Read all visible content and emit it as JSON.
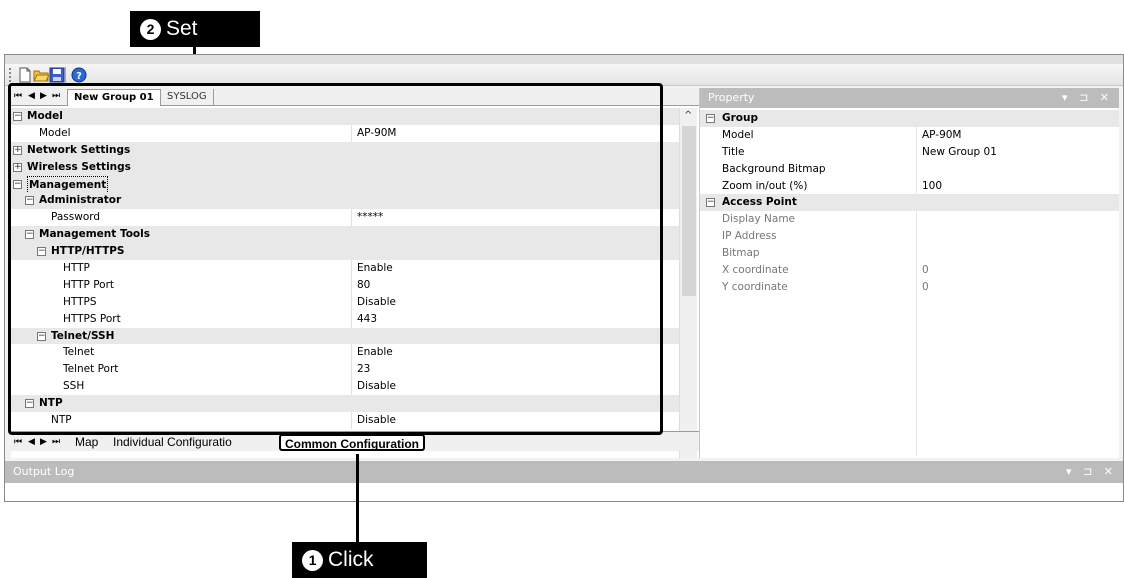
{
  "callouts": {
    "set": {
      "num": "2",
      "label": "Set"
    },
    "click": {
      "num": "1",
      "label": "Click"
    }
  },
  "tabs": {
    "top": [
      "New Group 01",
      "SYSLOG"
    ],
    "bottom": [
      "Map",
      "Individual Configuratio",
      "Common Configuration"
    ]
  },
  "grid_rows": [
    {
      "label": "Model",
      "value": "",
      "level": 0,
      "cat": true,
      "toggle": "minus"
    },
    {
      "label": "Model",
      "value": "AP-90M",
      "level": 0,
      "cat": false
    },
    {
      "label": "Network Settings",
      "value": "",
      "level": 0,
      "cat": true,
      "toggle": "plus"
    },
    {
      "label": "Wireless Settings",
      "value": "",
      "level": 0,
      "cat": true,
      "toggle": "plus"
    },
    {
      "label": "Management",
      "value": "",
      "level": 0,
      "cat": true,
      "toggle": "minus",
      "boxed": true
    },
    {
      "label": "Administrator",
      "value": "",
      "level": 1,
      "cat": true,
      "toggle": "minus"
    },
    {
      "label": "Password",
      "value": "*****",
      "level": 1,
      "cat": false
    },
    {
      "label": "Management Tools",
      "value": "",
      "level": 1,
      "cat": true,
      "toggle": "minus"
    },
    {
      "label": "HTTP/HTTPS",
      "value": "",
      "level": 2,
      "cat": true,
      "toggle": "minus"
    },
    {
      "label": "HTTP",
      "value": "Enable",
      "level": 2,
      "cat": false
    },
    {
      "label": "HTTP Port",
      "value": "80",
      "level": 2,
      "cat": false
    },
    {
      "label": "HTTPS",
      "value": "Disable",
      "level": 2,
      "cat": false
    },
    {
      "label": "HTTPS Port",
      "value": "443",
      "level": 2,
      "cat": false
    },
    {
      "label": "Telnet/SSH",
      "value": "",
      "level": 2,
      "cat": true,
      "toggle": "minus"
    },
    {
      "label": "Telnet",
      "value": "Enable",
      "level": 2,
      "cat": false
    },
    {
      "label": "Telnet Port",
      "value": "23",
      "level": 2,
      "cat": false
    },
    {
      "label": "SSH",
      "value": "Disable",
      "level": 2,
      "cat": false
    },
    {
      "label": "NTP",
      "value": "",
      "level": 1,
      "cat": true,
      "toggle": "minus"
    },
    {
      "label": "NTP",
      "value": "Disable",
      "level": 1,
      "cat": false
    }
  ],
  "property": {
    "title": "Property",
    "rows": [
      {
        "label": "Group",
        "value": "",
        "cat": true
      },
      {
        "label": "Model",
        "value": "AP-90M",
        "cat": false,
        "dim": false
      },
      {
        "label": "Title",
        "value": "New Group 01",
        "cat": false,
        "dim": false
      },
      {
        "label": "Background Bitmap",
        "value": "",
        "cat": false,
        "dim": false
      },
      {
        "label": "Zoom in/out (%)",
        "value": "100",
        "cat": false,
        "dim": false
      },
      {
        "label": "Access Point",
        "value": "",
        "cat": true
      },
      {
        "label": "Display Name",
        "value": "",
        "cat": false,
        "dim": true
      },
      {
        "label": "IP Address",
        "value": "",
        "cat": false,
        "dim": true
      },
      {
        "label": "Bitmap",
        "value": "",
        "cat": false,
        "dim": true
      },
      {
        "label": "X coordinate",
        "value": "0",
        "cat": false,
        "dim": true
      },
      {
        "label": "Y coordinate",
        "value": "0",
        "cat": false,
        "dim": true
      }
    ]
  },
  "output_log": {
    "title": "Output Log"
  },
  "pane_controls": "▾ ⊐ ✕",
  "toolbar": {
    "icons": [
      "new-file-icon",
      "open-folder-icon",
      "save-icon",
      "help-icon"
    ]
  }
}
